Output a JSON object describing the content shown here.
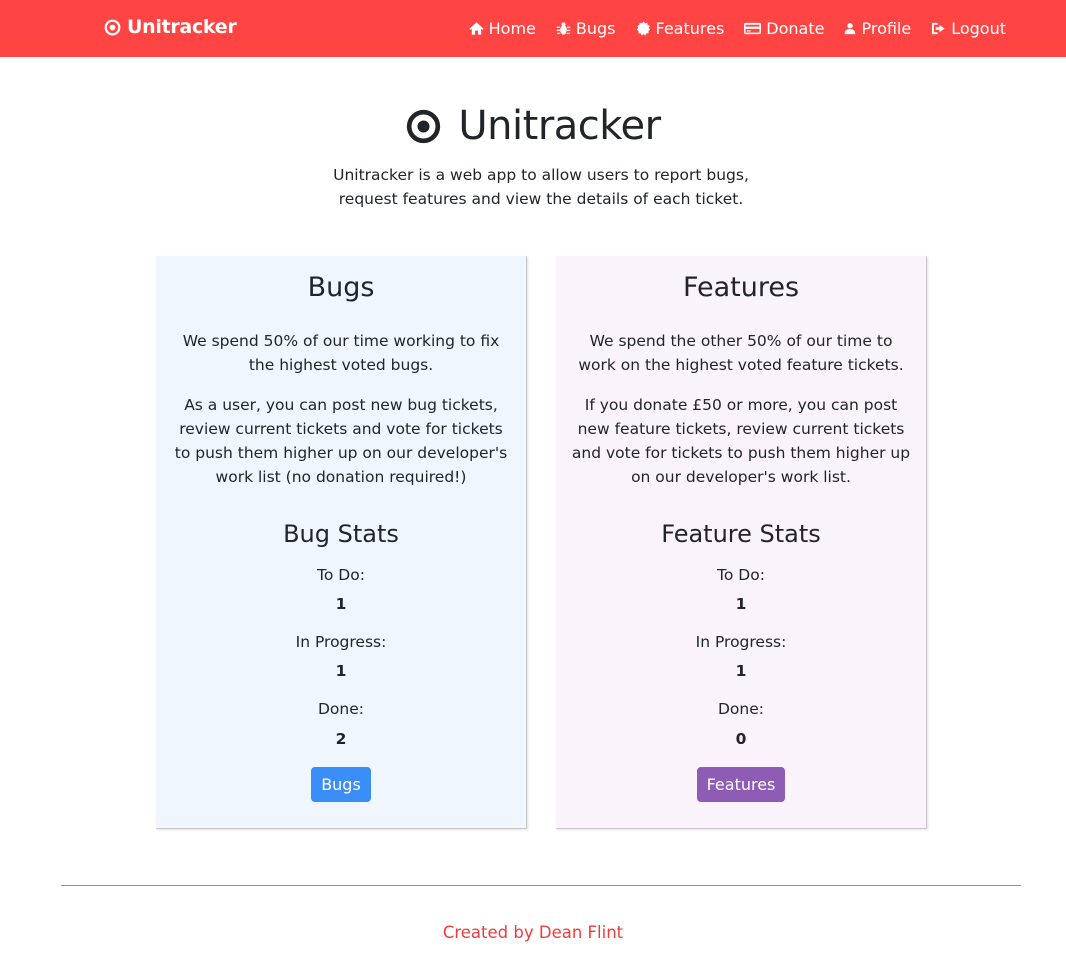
{
  "colors": {
    "navbar": "#ff4444",
    "bugs_card": "#f0f6fd",
    "features_card": "#faf3fc",
    "bugs_button": "#3b8ef7",
    "features_button": "#8e5cb5",
    "footer_text": "#ee3c3c"
  },
  "navbar": {
    "brand": {
      "icon": "target-circle-icon",
      "label": "Unitracker"
    },
    "links": [
      {
        "icon": "home-icon",
        "label": "Home"
      },
      {
        "icon": "bug-icon",
        "label": "Bugs"
      },
      {
        "icon": "certificate-icon",
        "label": "Features"
      },
      {
        "icon": "credit-card-icon",
        "label": "Donate"
      },
      {
        "icon": "user-icon",
        "label": "Profile"
      },
      {
        "icon": "sign-out-icon",
        "label": "Logout"
      }
    ]
  },
  "hero": {
    "icon": "target-circle-icon",
    "title": "Unitracker",
    "description": "Unitracker is a web app to allow users to report bugs, request features and view the details of each ticket."
  },
  "bugs_card": {
    "title": "Bugs",
    "paragraph1": "We spend 50% of our time working to fix the highest voted bugs.",
    "paragraph2": "As a user, you can post new bug tickets, review current tickets and vote for tickets to push them higher up on our developer's work list (no donation required!)",
    "stats_title": "Bug Stats",
    "stats": [
      {
        "label": "To Do:",
        "value": "1"
      },
      {
        "label": "In Progress:",
        "value": "1"
      },
      {
        "label": "Done:",
        "value": "2"
      }
    ],
    "button_label": "Bugs"
  },
  "features_card": {
    "title": "Features",
    "paragraph1": "We spend the other 50% of our time to work on the highest voted feature tickets.",
    "paragraph2": "If you donate £50 or more, you can post new feature tickets, review current tickets and vote for tickets to push them higher up on our developer's work list.",
    "stats_title": "Feature Stats",
    "stats": [
      {
        "label": "To Do:",
        "value": "1"
      },
      {
        "label": "In Progress:",
        "value": "1"
      },
      {
        "label": "Done:",
        "value": "0"
      }
    ],
    "button_label": "Features"
  },
  "footer": {
    "text": "Created by Dean Flint"
  }
}
